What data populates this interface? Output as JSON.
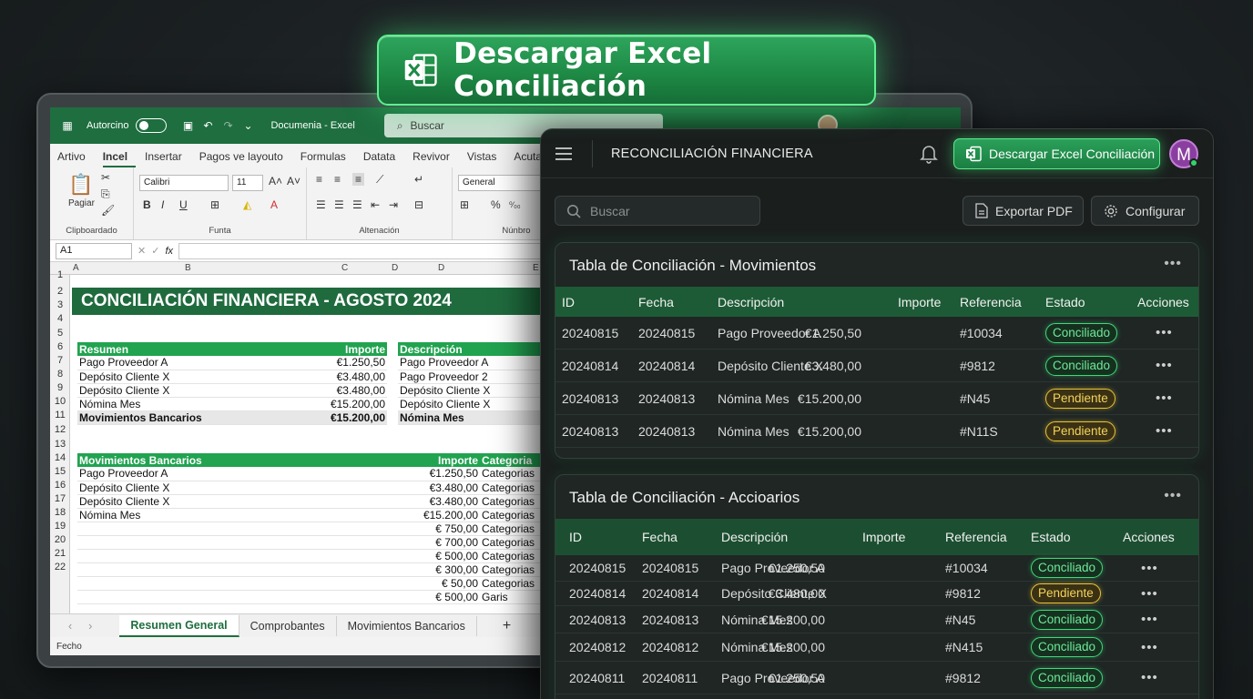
{
  "hero": {
    "label": "Descargar Excel Conciliación",
    "accent": "#2ea55c"
  },
  "excel": {
    "autosave_label": "Autorcino",
    "doc_name": "Documenia - Excel",
    "search_placeholder": "Buscar",
    "menu": [
      "Artivo",
      "Incel",
      "Insertar",
      "Pagos ve layouto",
      "Formulas",
      "Datata",
      "Revivor",
      "Vistas",
      "Acuta"
    ],
    "ribbon": {
      "clipboard": {
        "paste": "Pagiar",
        "group": "Clipboardado"
      },
      "font": {
        "name": "Calibri",
        "size": "11",
        "group": "Funta"
      },
      "align": {
        "group": "Altenación"
      },
      "number": {
        "format": "General",
        "group": "Núnbro"
      }
    },
    "name_box": "A1",
    "columns": [
      "A",
      "B",
      "C",
      "D",
      "D",
      "E"
    ],
    "title": "CONCILIACIÓN FINANCIERA - AGOSTO 2024",
    "summary": {
      "header": [
        "Resumen",
        "Importe"
      ],
      "rows": [
        [
          "Pago Proveedor A",
          "€1.250,50"
        ],
        [
          "Depósito Cliente X",
          "€3.480,00"
        ],
        [
          "Depósito Cliente X",
          "€3.480,00"
        ],
        [
          "Nómina Mes",
          "€15.200,00"
        ]
      ],
      "total": [
        "Movimientos Bancarios",
        "€15.200,00"
      ]
    },
    "desc": {
      "header": "Descripción",
      "rows": [
        "Pago Proveedor A",
        "Pago Proveedor 2",
        "Depósito Cliente X",
        "Depósito Cliente X"
      ],
      "total": "Nómina Mes"
    },
    "bank": {
      "header": [
        "Movimientos Bancarios",
        "Importe",
        "Categoria"
      ],
      "rows": [
        [
          "Pago Proveedor A",
          "€1.250,50",
          "Categorias"
        ],
        [
          "Depósito Cliente X",
          "€3.480,00",
          "Categorias"
        ],
        [
          "Depósito Cliente X",
          "€3.480,00",
          "Categorias"
        ],
        [
          "Nómina Mes",
          "€15.200,00",
          "Categorias"
        ],
        [
          "",
          "€ 750,00",
          "Categorias"
        ],
        [
          "",
          "€ 700,00",
          "Categorias"
        ],
        [
          "",
          "€ 500,00",
          "Categorias"
        ],
        [
          "",
          "€ 300,00",
          "Categorias"
        ],
        [
          "",
          "€ 50,00",
          "Categorias"
        ],
        [
          "",
          "€ 500,00",
          "Garis"
        ]
      ]
    },
    "row_numbers": [
      "1",
      "2",
      "3",
      "4",
      "5",
      "6",
      "7",
      "8",
      "9",
      "10",
      "11",
      "12",
      "13",
      "14",
      "15",
      "16",
      "17",
      "18",
      "19",
      "20",
      "21",
      "22"
    ],
    "sheets": [
      "Resumen General",
      "Comprobantes",
      "Movimientos Bancarios"
    ],
    "status": "Fecho"
  },
  "app": {
    "title": "RECONCILIACIÓN FINANCIERA",
    "download_label": "Descargar Excel Conciliación",
    "avatar_initial": "M",
    "search_placeholder": "Buscar",
    "export_label": "Exportar PDF",
    "config_label": "Configurar",
    "columns": [
      "ID",
      "Fecha",
      "Descripción",
      "Importe",
      "Referencia",
      "Estado",
      "Acciones"
    ],
    "table1": {
      "title": "Tabla de Conciliación - Movimientos",
      "rows": [
        [
          "20240815",
          "20240815",
          "Pago Proveedor A",
          "€1.250,50",
          "#10034",
          "Conciliado"
        ],
        [
          "20240814",
          "20240814",
          "Depósito Cliente X",
          "€3.480,00",
          "#9812",
          "Conciliado"
        ],
        [
          "20240813",
          "20240813",
          "Nómina Mes",
          "€15.200,00",
          "#N45",
          "Pendiente"
        ],
        [
          "20240813",
          "20240813",
          "Nómina Mes",
          "€15.200,00",
          "#N11S",
          "Pendiente"
        ]
      ]
    },
    "table2": {
      "title": "Tabla de Conciliación - Accioarios",
      "rows": [
        [
          "20240815",
          "20240815",
          "Pago Proveedor A",
          "€1.250,50",
          "#10034",
          "Conciliado"
        ],
        [
          "20240814",
          "20240814",
          "Depósito Cliente X",
          "€3.480,00",
          "#9812",
          "Pendiente"
        ],
        [
          "20240813",
          "20240813",
          "Nómina Mes",
          "€15.200,00",
          "#N45",
          "Conciliado"
        ],
        [
          "20240812",
          "20240812",
          "Nómina Mes",
          "€15.200,00",
          "#N415",
          "Conciliado"
        ],
        [
          "20240811",
          "20240811",
          "Pago Proveedor A",
          "€1.250,50",
          "#9812",
          "Conciliado"
        ]
      ]
    }
  }
}
